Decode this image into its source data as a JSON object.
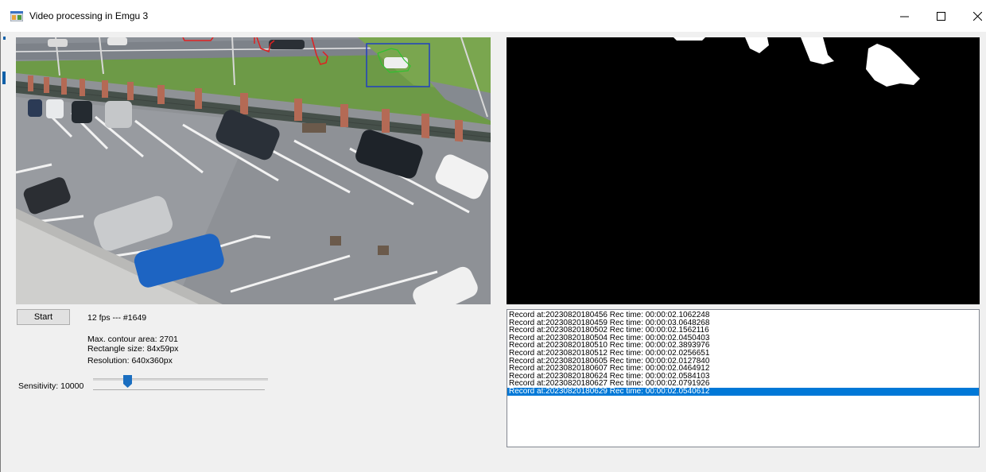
{
  "window": {
    "title": "Video processing in Emgu 3"
  },
  "controls": {
    "start_label": "Start",
    "fps_label": "12 fps --- #1649",
    "contour_label": "Max. contour area: 2701",
    "rect_label": "Rectangle size: 84x59px",
    "resolution_label": "Resolution: 640x360px",
    "sensitivity_label": "Sensitivity: 10000",
    "slider_position_fraction": 0.18
  },
  "log": {
    "records": [
      "Record at:20230820180456 Rec time: 00:00:02.1062248",
      "Record at:20230820180459 Rec time: 00:00:03.0648268",
      "Record at:20230820180502 Rec time: 00:00:02.1562116",
      "Record at:20230820180504 Rec time: 00:00:02.0450403",
      "Record at:20230820180510 Rec time: 00:00:02.3893976",
      "Record at:20230820180512 Rec time: 00:00:02.0256651",
      "Record at:20230820180605 Rec time: 00:00:02.0127840",
      "Record at:20230820180607 Rec time: 00:00:02.0464912",
      "Record at:20230820180624 Rec time: 00:00:02.0584103",
      "Record at:20230820180627 Rec time: 00:00:02.0791926",
      "Record at:20230820180629 Rec time: 00:00:02.0540612"
    ],
    "selected_index": 10
  },
  "colors": {
    "selection": "#0078d7",
    "accent": "#1a6ec0",
    "detection_box": "#2040c0",
    "detection_contour": "#30c030",
    "motion_contour": "#e02020"
  },
  "icons": {
    "app": "app-window-icon",
    "minimize": "minimize-icon",
    "maximize": "maximize-icon",
    "close": "close-icon"
  }
}
